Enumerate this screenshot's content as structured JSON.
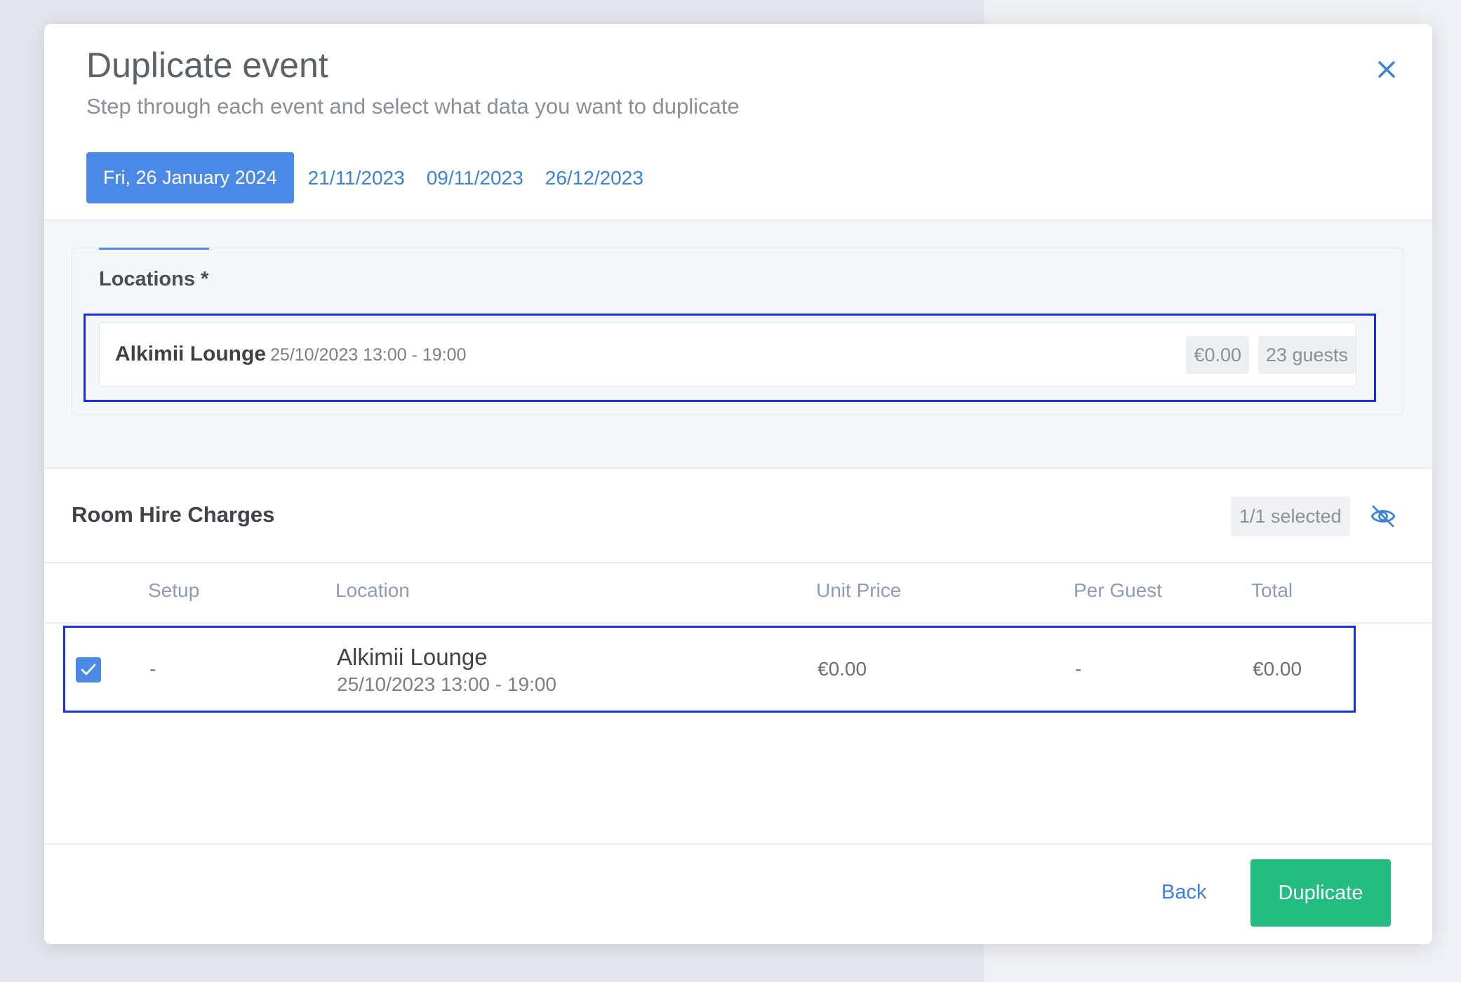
{
  "modal": {
    "title": "Duplicate event",
    "subtitle": "Step through each event and select what data you want to duplicate"
  },
  "tabs": [
    {
      "label": "Fri, 26 January 2024",
      "active": true
    },
    {
      "label": "21/11/2023",
      "active": false
    },
    {
      "label": "09/11/2023",
      "active": false
    },
    {
      "label": "26/12/2023",
      "active": false
    }
  ],
  "locations": {
    "title": "Locations *",
    "item": {
      "name": "Alkimii Lounge",
      "time": "25/10/2023 13:00 - 19:00",
      "price": "€0.00",
      "guests": "23 guests"
    }
  },
  "room_hire": {
    "title": "Room Hire Charges",
    "selected": "1/1 selected",
    "columns": [
      "Setup",
      "Location",
      "Unit Price",
      "Per Guest",
      "Total"
    ],
    "rows": [
      {
        "checked": true,
        "setup": "-",
        "location_name": "Alkimii Lounge",
        "location_time": "25/10/2023 13:00 - 19:00",
        "unit_price": "€0.00",
        "per_guest": "-",
        "total": "€0.00"
      }
    ]
  },
  "footer": {
    "back_label": "Back",
    "duplicate_label": "Duplicate"
  },
  "colors": {
    "primary": "#4a8ae6",
    "link": "#3c82d8",
    "success": "#23bd82",
    "highlight": "#1432d9"
  },
  "icons": {
    "close": "close-icon",
    "visibility": "eye-off-icon",
    "check": "check-icon"
  }
}
